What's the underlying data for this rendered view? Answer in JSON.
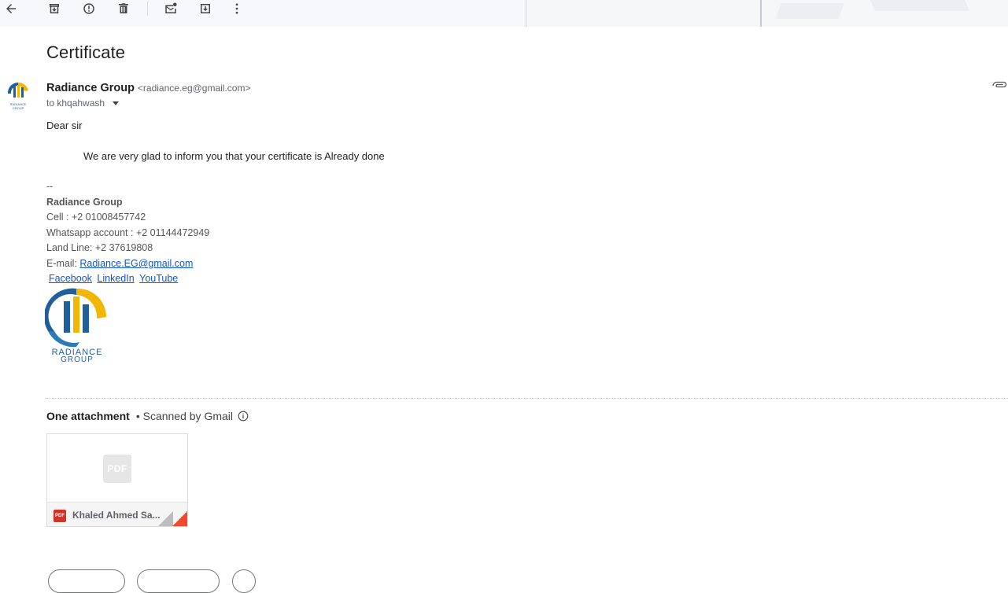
{
  "toolbar": {
    "icons": [
      "back-arrow-icon",
      "archive-icon",
      "report-spam-icon",
      "delete-icon",
      "mark-unread-icon",
      "move-to-icon",
      "more-vert-icon"
    ]
  },
  "email": {
    "subject": "Certificate",
    "sender_name": "Radiance Group",
    "sender_email": "<radiance.eg@gmail.com>",
    "to_line": "to khqahwash",
    "greeting": "Dear sir",
    "message": "We are very glad to inform you that your certificate is Already done"
  },
  "signature": {
    "dash": "--",
    "name": "Radiance Group",
    "cell": "Cell : +2 01008457742",
    "whatsapp": "Whatsapp account : +2 01144472949",
    "landline": "Land Line: +2 37619808",
    "email_label": "E-mail: ",
    "email_link": "Radiance.EG@gmail.com",
    "social": [
      "Facebook",
      "LinkedIn",
      "YouTube "
    ],
    "logo_text_line1": "RADIANCE",
    "logo_text_line2": "GROUP"
  },
  "attachments": {
    "heading": "One attachment",
    "scanned": "• Scanned by Gmail",
    "file_type": "PDF",
    "file_badge": "PDF",
    "file_name": "Khaled Ahmed Sa..."
  },
  "colors": {
    "link": "#1155cc",
    "brand_blue": "#1f5f9e",
    "brand_yellow": "#f2b705",
    "pdf_red": "#d93025"
  }
}
